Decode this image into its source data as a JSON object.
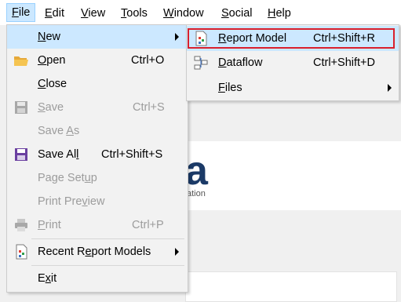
{
  "menubar": {
    "items": [
      {
        "label": "File",
        "key": "F",
        "rest": "ile"
      },
      {
        "label": "Edit",
        "key": "E",
        "rest": "dit"
      },
      {
        "label": "View",
        "key": "V",
        "rest": "iew"
      },
      {
        "label": "Tools",
        "key": "T",
        "rest": "ools"
      },
      {
        "label": "Window",
        "key": "W",
        "rest": "indow"
      },
      {
        "label": "Social",
        "key": "S",
        "rest": "ocial"
      },
      {
        "label": "Help",
        "key": "H",
        "rest": "elp"
      }
    ]
  },
  "background": {
    "logo_text": "a",
    "tagline": "ation"
  },
  "file_menu": {
    "new": {
      "key": "N",
      "rest": "ew"
    },
    "open": {
      "key": "O",
      "rest": "pen",
      "shortcut": "Ctrl+O"
    },
    "close": {
      "key": "C",
      "rest": "lose"
    },
    "save": {
      "key": "S",
      "rest": "ave",
      "shortcut": "Ctrl+S"
    },
    "save_as": {
      "pre": "Save ",
      "key": "A",
      "rest": "s"
    },
    "save_all": {
      "pre": "Save Al",
      "key": "l",
      "rest": "",
      "shortcut": "Ctrl+Shift+S"
    },
    "page_setup": {
      "pre": "Page Set",
      "key": "u",
      "rest": "p"
    },
    "print_preview": {
      "pre": "Print Pre",
      "key": "v",
      "rest": "iew"
    },
    "print": {
      "key": "P",
      "rest": "rint",
      "shortcut": "Ctrl+P"
    },
    "recent": {
      "pre": "Recent R",
      "key": "e",
      "rest": "port Models"
    },
    "exit": {
      "pre": "E",
      "key": "x",
      "rest": "it"
    }
  },
  "new_menu": {
    "report_model": {
      "key": "R",
      "rest": "eport Model",
      "shortcut": "Ctrl+Shift+R"
    },
    "dataflow": {
      "key": "D",
      "rest": "ataflow",
      "shortcut": "Ctrl+Shift+D"
    },
    "files": {
      "key": "F",
      "rest": "iles"
    }
  },
  "colors": {
    "highlight": "#cce8ff",
    "annotation_box": "#d9202c",
    "disabled_text": "#9c9c9c"
  }
}
